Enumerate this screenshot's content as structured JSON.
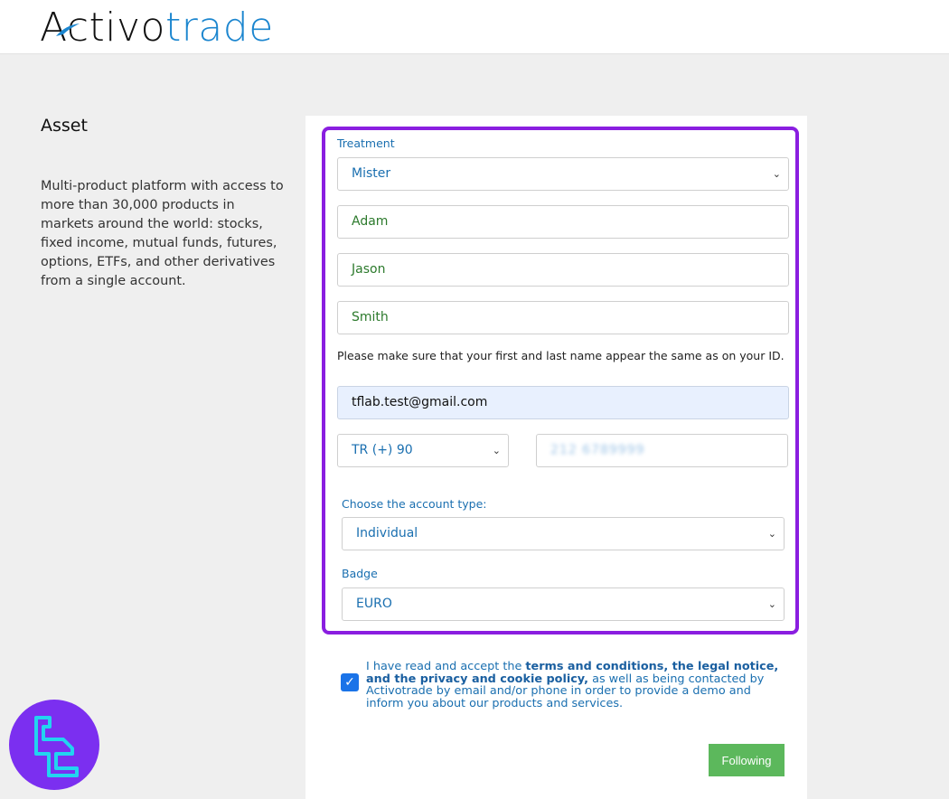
{
  "brand": {
    "logo_part1": "Activo",
    "logo_part2": "trade"
  },
  "left": {
    "title": "Asset",
    "description": "Multi-product platform with access to more than 30,000 products in markets around the world: stocks, fixed income, mutual funds, futures, options, ETFs, and other derivatives from a single account."
  },
  "form": {
    "treatment_label": "Treatment",
    "treatment_value": "Mister",
    "first_name": "Adam",
    "middle_name": "Jason",
    "last_name": "Smith",
    "name_note": "Please make sure that your first and last name appear the same as on your ID.",
    "email": "tflab.test@gmail.com",
    "phone_code": "TR (+) 90",
    "phone_number": "212 6789999",
    "account_type_label": "Choose the account type:",
    "account_type_value": "Individual",
    "badge_label": "Badge",
    "badge_value": "EURO",
    "consent_text_1": "I have read and accept the ",
    "consent_bold": "terms and conditions, the legal notice, and the privacy and cookie policy,",
    "consent_text_2": " as well as being contacted by Activotrade by email and/or phone in order to provide a demo and inform you about our products and services.",
    "consent_checked": true,
    "submit_label": "Following"
  },
  "colors": {
    "accent": "#1a6fb0",
    "highlight": "#8a1ee0",
    "submit": "#5cb85c",
    "badge_bg": "#7b2ff0"
  },
  "icons": {
    "select_chevron": "chevron-down-icon",
    "checkbox": "checkmark-icon",
    "watermark": "tl-logo-icon"
  }
}
